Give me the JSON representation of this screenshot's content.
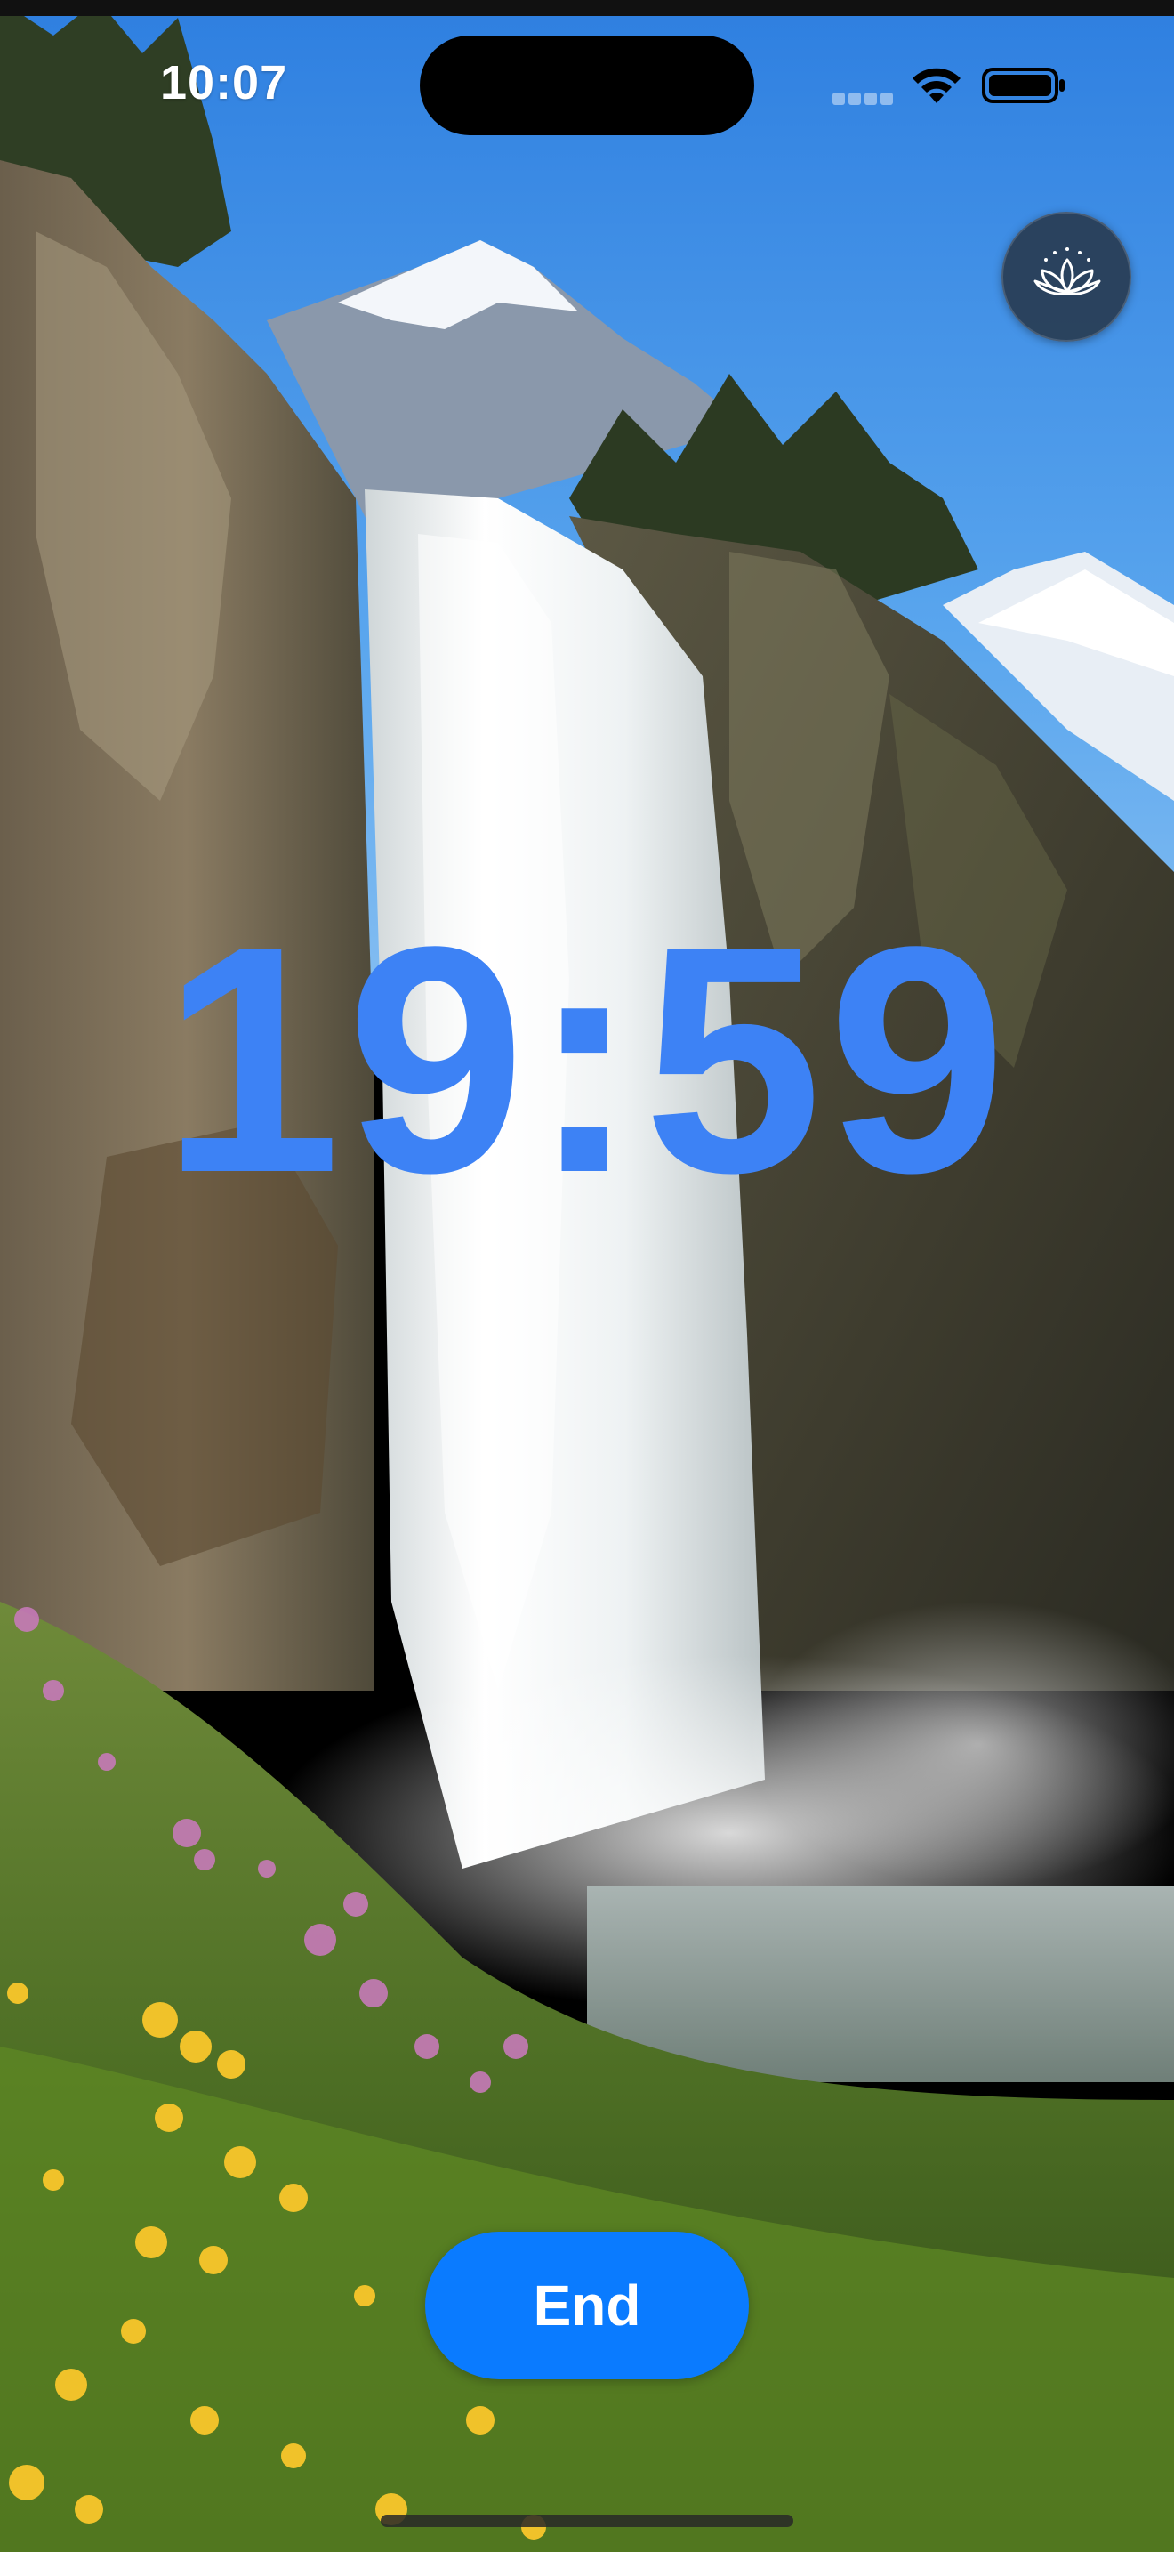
{
  "status_bar": {
    "time": "10:07"
  },
  "background": {
    "icon": "waterfall-scene-image"
  },
  "meditation": {
    "icon": "lotus-icon"
  },
  "timer": {
    "display": "19:59"
  },
  "end_button": {
    "label": "End"
  },
  "colors": {
    "timer": "#3d82f5",
    "button": "#0a7bff",
    "meditation_button": "#283c52"
  }
}
